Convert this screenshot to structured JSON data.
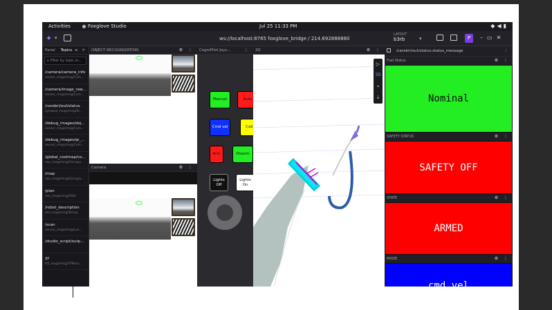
{
  "system_bar": {
    "activities": "Activities",
    "app_name": "Foxglove Studio",
    "clock": "Jul 25  11:33 PM",
    "tray_icons": [
      "wifi-icon",
      "volume-icon",
      "battery-icon"
    ]
  },
  "app_bar": {
    "connection": "ws://localhost:8765 foxglove_bridge / 214.692888880",
    "layout_caption": "LAYOUT",
    "layout_name": "b3rb",
    "user_initial": "P"
  },
  "left_sidebar": {
    "tabs": [
      "Panel",
      "Topics"
    ],
    "active_tab": "Topics",
    "filter_placeholder": "Filter by topic or...",
    "topics": [
      {
        "name": "/camera/camera_info",
        "type": "sensor_msgs/msg/Cam..."
      },
      {
        "name": "/camera/image_raw...",
        "type": "sensor_msgs/msg/Com..."
      },
      {
        "name": "/cerebri/out/status",
        "type": "synapse_msgs/msg/St..."
      },
      {
        "name": "/debug_images/obj...",
        "type": "sensor_msgs/msg/Com..."
      },
      {
        "name": "/debug_images/qr_...",
        "type": "sensor_msgs/msg/Com..."
      },
      {
        "name": "/global_costmap/co...",
        "type": "nav_msgs/msg/Occupa..."
      },
      {
        "name": "/map",
        "type": "nav_msgs/msg/Occupa..."
      },
      {
        "name": "/plan",
        "type": "nav_msgs/msg/Path"
      },
      {
        "name": "/robot_description",
        "type": "std_msgs/msg/String"
      },
      {
        "name": "/scan",
        "type": "sensor_msgs/msg/Las..."
      },
      {
        "name": "/studio_script/outp...",
        "type": ""
      },
      {
        "name": "/tf",
        "type": "tf2_msgs/msg/TFMess..."
      }
    ]
  },
  "panels": {
    "object_recognization": "OBJECT RECOGNIZATION",
    "camera": "Camera",
    "joystick": "CogniPilot Joys...",
    "three_d": "3D",
    "status_path": "/cerebri/out/status.status_message"
  },
  "joystick_buttons": [
    {
      "label": "Manual",
      "color": "#22ee22"
    },
    {
      "label": "Auto",
      "color": "#ff1a1a"
    },
    {
      "label": "Cmd vel",
      "color": "#1030ff"
    },
    {
      "label": "Calib",
      "color": "#ffff00"
    },
    {
      "label": "Arm",
      "color": "#ff1a1a"
    },
    {
      "label": "Disarm",
      "color": "#22ee22"
    },
    {
      "label": "Lights Off",
      "color": "#111111"
    },
    {
      "label": "Lights On",
      "color": "#ffffff"
    }
  ],
  "indicators": [
    {
      "title": "Fuel Status",
      "value": "Nominal",
      "bg": "#22ee22",
      "fg": "#111111"
    },
    {
      "title": "SAFETY STATUS",
      "value": "SAFETY OFF",
      "bg": "#ff0000",
      "fg": "#ffffff"
    },
    {
      "title": "STATE",
      "value": "ARMED",
      "bg": "#ff0000",
      "fg": "#ffffff"
    },
    {
      "title": "MODE",
      "value": "cmd_vel",
      "bg": "#0000ff",
      "fg": "#ffffff"
    }
  ]
}
